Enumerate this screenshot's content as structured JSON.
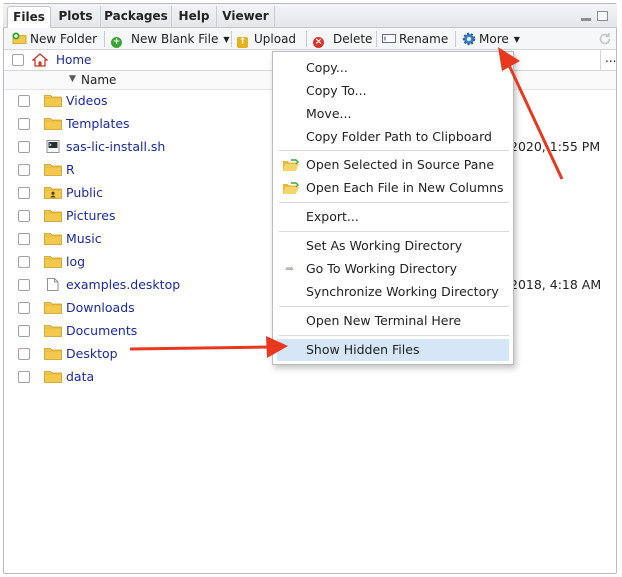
{
  "tabs": [
    "Files",
    "Plots",
    "Packages",
    "Help",
    "Viewer"
  ],
  "toolbar": {
    "new_folder": "New Folder",
    "new_blank_file": "New Blank File",
    "upload": "Upload",
    "delete": "Delete",
    "rename": "Rename",
    "more": "More"
  },
  "path": {
    "home": "Home",
    "overflow": "..."
  },
  "header": {
    "name": "Name"
  },
  "files": [
    {
      "name": "Videos",
      "type": "folder",
      "modified": ""
    },
    {
      "name": "Templates",
      "type": "folder",
      "modified": ""
    },
    {
      "name": "sas-lic-install.sh",
      "type": "script",
      "modified": "2020, 1:55 PM"
    },
    {
      "name": "R",
      "type": "folder",
      "modified": ""
    },
    {
      "name": "Public",
      "type": "public-folder",
      "modified": ""
    },
    {
      "name": "Pictures",
      "type": "folder",
      "modified": ""
    },
    {
      "name": "Music",
      "type": "folder",
      "modified": ""
    },
    {
      "name": "log",
      "type": "folder",
      "modified": ""
    },
    {
      "name": "examples.desktop",
      "type": "file",
      "modified": "2018, 4:18 AM"
    },
    {
      "name": "Downloads",
      "type": "folder",
      "modified": ""
    },
    {
      "name": "Documents",
      "type": "folder",
      "modified": ""
    },
    {
      "name": "Desktop",
      "type": "folder",
      "modified": ""
    },
    {
      "name": "data",
      "type": "folder",
      "modified": ""
    }
  ],
  "menu": {
    "items": [
      "Copy...",
      "Copy To...",
      "Move...",
      "Copy Folder Path to Clipboard",
      "Open Selected in Source Pane",
      "Open Each File in New Columns",
      "Export...",
      "Set As Working Directory",
      "Go To Working Directory",
      "Synchronize Working Directory",
      "Open New Terminal Here",
      "Show Hidden Files"
    ],
    "highlighted": "Show Hidden Files"
  },
  "colors": {
    "link": "#1a2a9a",
    "folder": "#f2c94c",
    "menu_highlight": "#d5e6f7",
    "annotation_arrow": "#e8391f"
  }
}
